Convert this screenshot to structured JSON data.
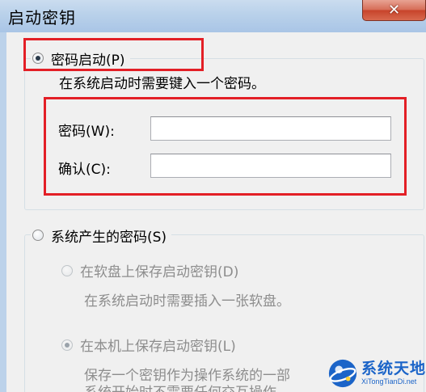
{
  "window": {
    "title": "启动密钥",
    "close_glyph": "✕"
  },
  "option_password": {
    "label": "密码启动(P)",
    "checked": true,
    "description": "在系统启动时需要键入一个密码。",
    "fields": {
      "password_label": "密码(W):",
      "password_value": "",
      "confirm_label": "确认(C):",
      "confirm_value": ""
    }
  },
  "option_system": {
    "label": "系统产生的密码(S)",
    "checked": false,
    "sub_floppy": {
      "label": "在软盘上保存启动密钥(D)",
      "description": "在系统启动时需要插入一张软盘。",
      "checked": false
    },
    "sub_local": {
      "label": "在本机上保存启动密钥(L)",
      "description_line1": "保存一个密钥作为操作系统的一部",
      "description_line2": "系统开始时不需要任何交互操作。",
      "checked": true
    }
  },
  "watermark": {
    "main": "系统天地",
    "sub": "XiTongTianDi.net"
  },
  "colors": {
    "annotation_red": "#e31f26",
    "disabled_text": "#8d8d8d",
    "watermark_blue": "#1b64c8"
  }
}
